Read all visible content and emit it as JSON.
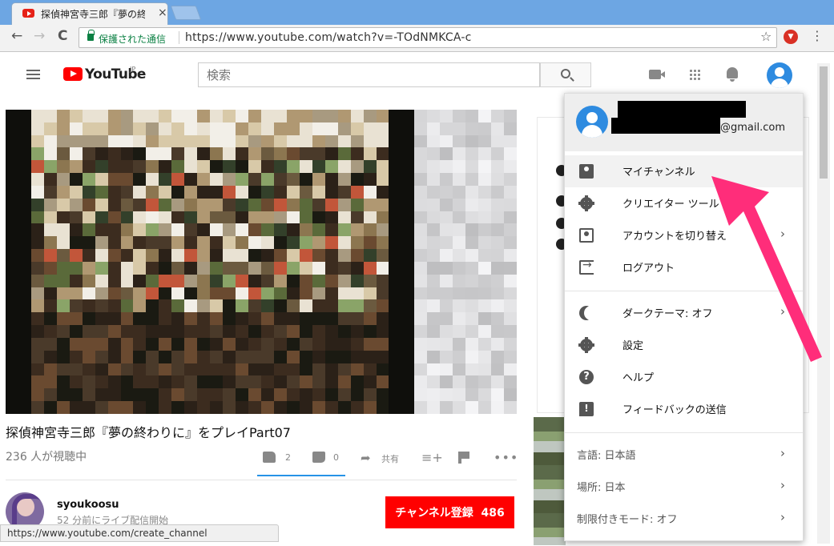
{
  "browser": {
    "tab_title": "探偵神宮寺三郎『夢の終わ",
    "tab_close": "×",
    "secure_text": "保護された通信",
    "url": "https://www.youtube.com/watch?v=-TOdNMKCA-c",
    "back": "←",
    "forward": "→",
    "reload": "C",
    "star": "☆",
    "menu": "⋮"
  },
  "header": {
    "logo_text": "YouTube",
    "logo_region": "JP",
    "search_placeholder": "検索"
  },
  "video": {
    "title": "探偵神宮寺三郎『夢の終わりに』をプレイPart07",
    "views": "236 人が視聴中",
    "like_count": "2",
    "dislike_count": "0",
    "share_label": "共有",
    "add_icon": "≡+",
    "more_icon": "•••",
    "like_ratio": 1.0
  },
  "channel": {
    "name": "syoukoosu",
    "subline": "52 分前にライブ配信開始",
    "subscribe_label": "チャンネル登録",
    "subscribe_count": "486"
  },
  "status_bar_url": "https://www.youtube.com/create_channel",
  "account_menu": {
    "email_suffix": "@gmail.com",
    "items": [
      {
        "label": "マイチャンネル",
        "icon": "person-icon"
      },
      {
        "label": "クリエイター ツール",
        "icon": "gear-icon"
      },
      {
        "label": "アカウントを切り替え",
        "icon": "switch-account-icon",
        "chevron": "›"
      },
      {
        "label": "ログアウト",
        "icon": "exit-icon"
      },
      {
        "label": "ダークテーマ: オフ",
        "icon": "moon-icon",
        "chevron": "›"
      },
      {
        "label": "設定",
        "icon": "gear-icon"
      },
      {
        "label": "ヘルプ",
        "icon": "help-icon",
        "glyph": "?"
      },
      {
        "label": "フィードバックの送信",
        "icon": "feedback-icon",
        "glyph": "!"
      }
    ],
    "footer_items": [
      {
        "label": "言語: 日本語",
        "chevron": "›"
      },
      {
        "label": "場所: 日本",
        "chevron": "›"
      },
      {
        "label": "制限付きモード: オフ",
        "chevron": "›"
      }
    ]
  },
  "colors": {
    "accent": "#ff0000",
    "annotation_arrow": "#ff2d7a",
    "link_blue": "#2793e6"
  }
}
